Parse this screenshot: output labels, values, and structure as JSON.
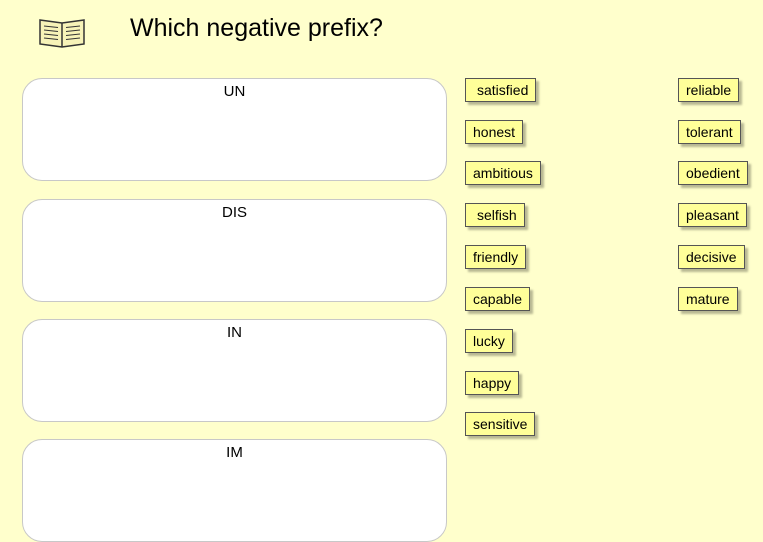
{
  "header": {
    "title": "Which negative prefix?",
    "icon": "book-icon"
  },
  "zones": [
    {
      "label": "UN"
    },
    {
      "label": "DIS"
    },
    {
      "label": "IN"
    },
    {
      "label": "IM"
    }
  ],
  "words_left": [
    "satisfied",
    "honest",
    "ambitious",
    "selfish",
    "friendly",
    "capable",
    "lucky",
    "happy",
    "sensitive"
  ],
  "words_right": [
    "reliable",
    "tolerant",
    "obedient",
    "pleasant",
    "decisive",
    "mature"
  ],
  "colors": {
    "background": "#ffffcc",
    "tile": "#ffff99",
    "zone": "#ffffff"
  }
}
